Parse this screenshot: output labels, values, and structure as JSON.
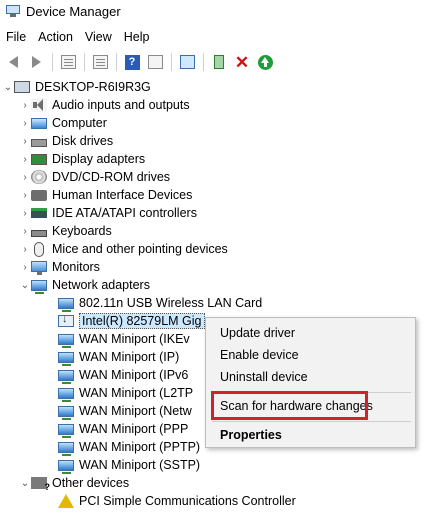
{
  "window": {
    "title": "Device Manager"
  },
  "menu": [
    "File",
    "Action",
    "View",
    "Help"
  ],
  "tree": {
    "root": "DESKTOP-R6I9R3G",
    "categories": [
      "Audio inputs and outputs",
      "Computer",
      "Disk drives",
      "Display adapters",
      "DVD/CD-ROM drives",
      "Human Interface Devices",
      "IDE ATA/ATAPI controllers",
      "Keyboards",
      "Mice and other pointing devices",
      "Monitors",
      "Network adapters"
    ],
    "network_adapters": [
      "802.11n USB Wireless LAN Card",
      "Intel(R) 82579LM Gig",
      "WAN Miniport (IKEv",
      "WAN Miniport (IP)",
      "WAN Miniport (IPv6",
      "WAN Miniport (L2TP",
      "WAN Miniport (Netw",
      "WAN Miniport (PPP",
      "WAN Miniport (PPTP)",
      "WAN Miniport (SSTP)"
    ],
    "other_devices_label": "Other devices",
    "other_devices": [
      "PCI Simple Communications Controller"
    ]
  },
  "context_menu": {
    "update_driver": "Update driver",
    "enable_device": "Enable device",
    "uninstall_device": "Uninstall device",
    "scan": "Scan for hardware changes",
    "properties": "Properties"
  },
  "colors": {
    "highlight_box": "#d0212f",
    "selection": "#cce8ff"
  }
}
